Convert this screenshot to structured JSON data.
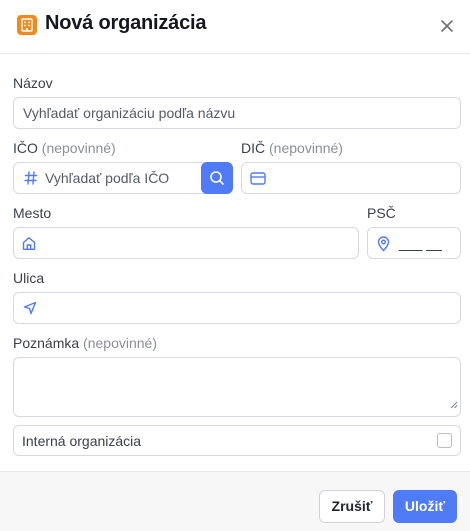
{
  "dialog": {
    "title": "Nová organizácia",
    "icon": "building-icon",
    "accent_color": "#f08a1c"
  },
  "form": {
    "name": {
      "label": "Názov",
      "placeholder": "Vyhľadať organizáciu podľa názvu"
    },
    "ico": {
      "label": "IČO",
      "optional": "(nepovinné)",
      "placeholder": "Vyhľadať podľa IČO",
      "icon": "hash-icon"
    },
    "dic": {
      "label": "DIČ",
      "optional": "(nepovinné)",
      "icon": "credit-card-icon"
    },
    "city": {
      "label": "Mesto",
      "icon": "home-icon"
    },
    "zip": {
      "label": "PSČ",
      "placeholder": "___ __",
      "icon": "map-pin-icon"
    },
    "street": {
      "label": "Ulica",
      "icon": "navigation-icon"
    },
    "note": {
      "label": "Poznámka",
      "optional": "(nepovinné)"
    },
    "internal": {
      "label": "Interná organizácia",
      "checked": false
    }
  },
  "footer": {
    "cancel_label": "Zrušiť",
    "save_label": "Uložiť",
    "primary_color": "#4f7cf6"
  }
}
